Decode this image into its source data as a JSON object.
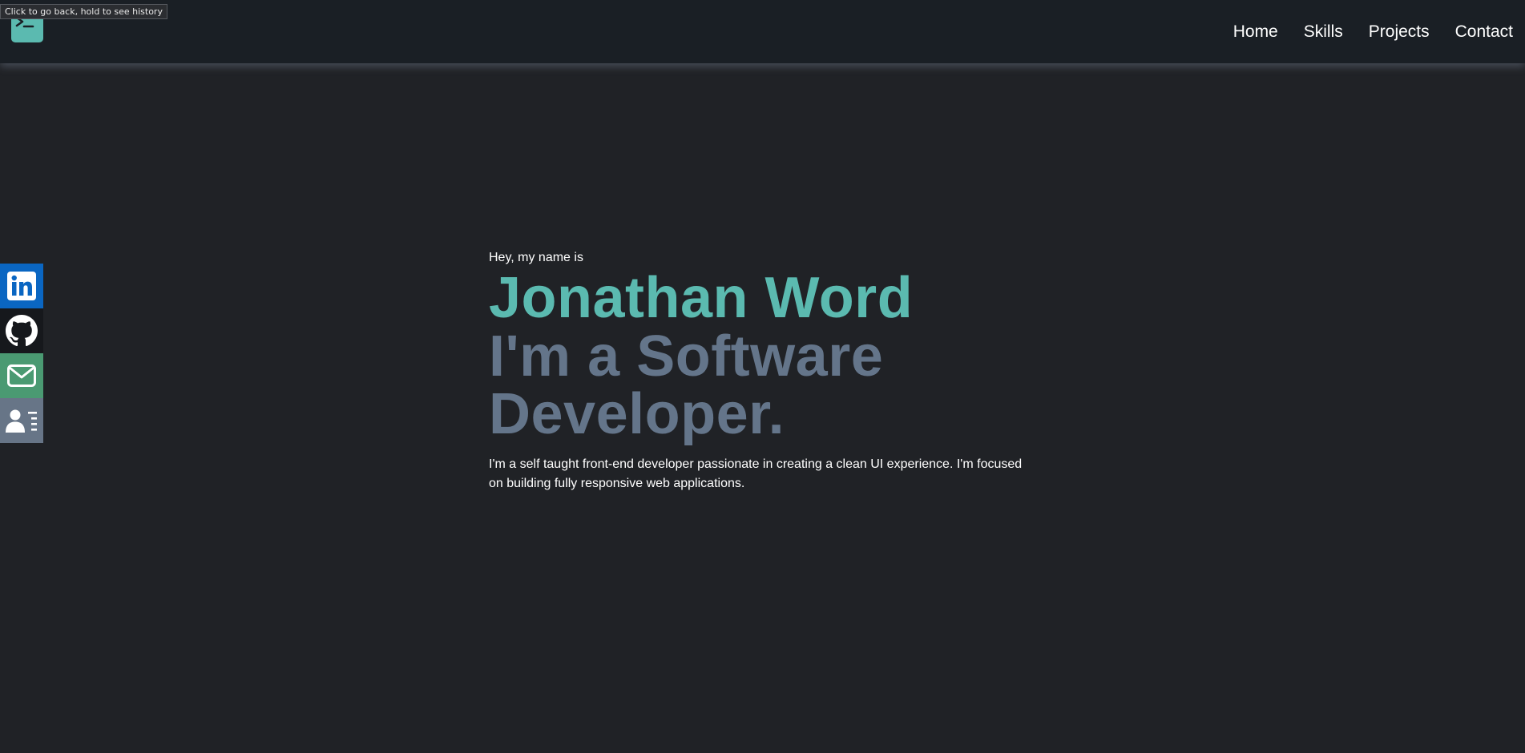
{
  "browser": {
    "tooltip": "Click to go back, hold to see history"
  },
  "header": {
    "logo_icon": "terminal-icon",
    "nav": [
      {
        "label": "Home"
      },
      {
        "label": "Skills"
      },
      {
        "label": "Projects"
      },
      {
        "label": "Contact"
      }
    ]
  },
  "social": [
    {
      "icon": "linkedin-icon",
      "color": "#0a66c2"
    },
    {
      "icon": "github-icon",
      "color": "#16181c"
    },
    {
      "icon": "email-icon",
      "color": "#4a9a72"
    },
    {
      "icon": "resume-icon",
      "color": "#677587"
    }
  ],
  "hero": {
    "intro": "Hey, my name is",
    "name": "Jonathan Word",
    "tagline": "I'm a Software Developer.",
    "about": "I'm a self taught front-end developer passionate in creating a clean UI experience. I'm focused on building fully responsive web applications."
  },
  "colors": {
    "background": "#202226",
    "header": "#1a1f25",
    "accent": "#5bbab0",
    "tagline": "#64758a"
  }
}
